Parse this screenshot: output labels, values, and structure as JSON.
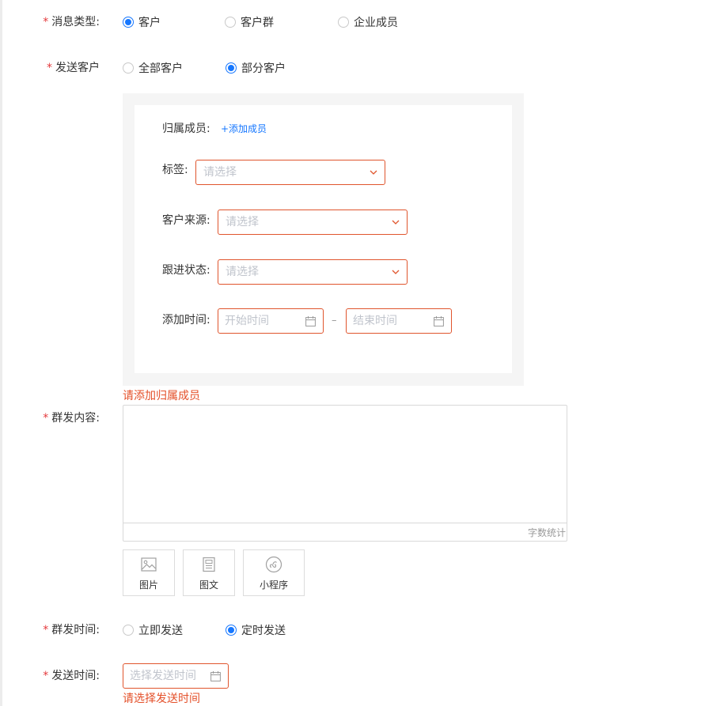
{
  "form": {
    "message_type": {
      "label": "消息类型:",
      "options": [
        "客户",
        "客户群",
        "企业成员"
      ],
      "selected": "客户"
    },
    "send_customers": {
      "label": "发送客户",
      "options": [
        "全部客户",
        "部分客户"
      ],
      "selected": "部分客户"
    },
    "filter": {
      "member_label": "归属成员:",
      "add_member": "+添加成员",
      "tags_label": "标签:",
      "tags_placeholder": "请选择",
      "source_label": "客户来源:",
      "source_placeholder": "请选择",
      "status_label": "跟进状态:",
      "status_placeholder": "请选择",
      "time_label": "添加时间:",
      "start_placeholder": "开始时间",
      "range_separator": "–",
      "end_placeholder": "结束时间"
    },
    "member_error": "请添加归属成员",
    "content": {
      "label": "群发内容:",
      "counter": "字数统计"
    },
    "attachments": [
      {
        "label": "图片",
        "icon": "image-icon"
      },
      {
        "label": "图文",
        "icon": "article-icon"
      },
      {
        "label": "小程序",
        "icon": "mini-program-icon"
      }
    ],
    "send_mode": {
      "label": "群发时间:",
      "options": [
        "立即发送",
        "定时发送"
      ],
      "selected": "定时发送"
    },
    "send_time": {
      "label": "发送时间:",
      "placeholder": "选择发送时间",
      "error": "请选择发送时间"
    }
  },
  "colors": {
    "required_star": "#e4393c",
    "primary": "#1677ff",
    "error": "#e4502a",
    "error_border": "#e0552d"
  }
}
